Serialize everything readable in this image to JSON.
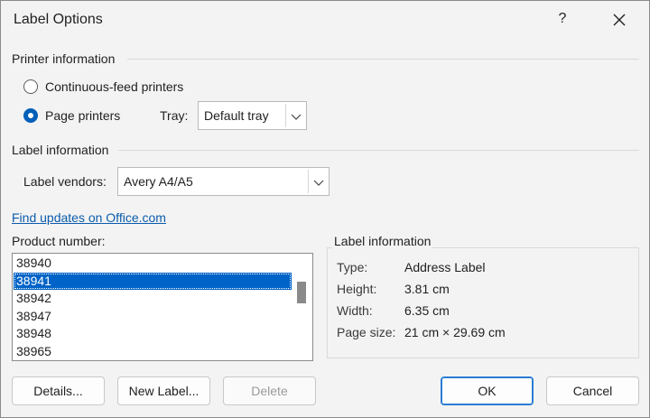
{
  "dialog": {
    "title": "Label Options",
    "help_label": "?",
    "close_icon": "close-icon"
  },
  "printer": {
    "section_label": "Printer information",
    "continuous_label": "Continuous-feed printers",
    "page_label": "Page printers",
    "selected": "page",
    "tray_label": "Tray:",
    "tray_value": "Default tray"
  },
  "label_info": {
    "section_label": "Label information",
    "vendors_label": "Label vendors:",
    "vendor_value": "Avery A4/A5",
    "updates_link": "Find updates on Office.com"
  },
  "product": {
    "label": "Product number:",
    "items": [
      "38940",
      "38941",
      "38942",
      "38947",
      "38948",
      "38965"
    ],
    "selected_index": 1
  },
  "details": {
    "legend": "Label information",
    "rows": [
      {
        "key": "Type:",
        "value": "Address Label"
      },
      {
        "key": "Height:",
        "value": "3.81 cm"
      },
      {
        "key": "Width:",
        "value": "6.35 cm"
      },
      {
        "key": "Page size:",
        "value": "21 cm × 29.69 cm"
      }
    ]
  },
  "buttons": {
    "details": "Details...",
    "new_label": "New Label...",
    "delete": "Delete",
    "ok": "OK",
    "cancel": "Cancel"
  },
  "colors": {
    "accent": "#005fb8",
    "selection": "#0063c7",
    "link": "#0b5cad"
  }
}
